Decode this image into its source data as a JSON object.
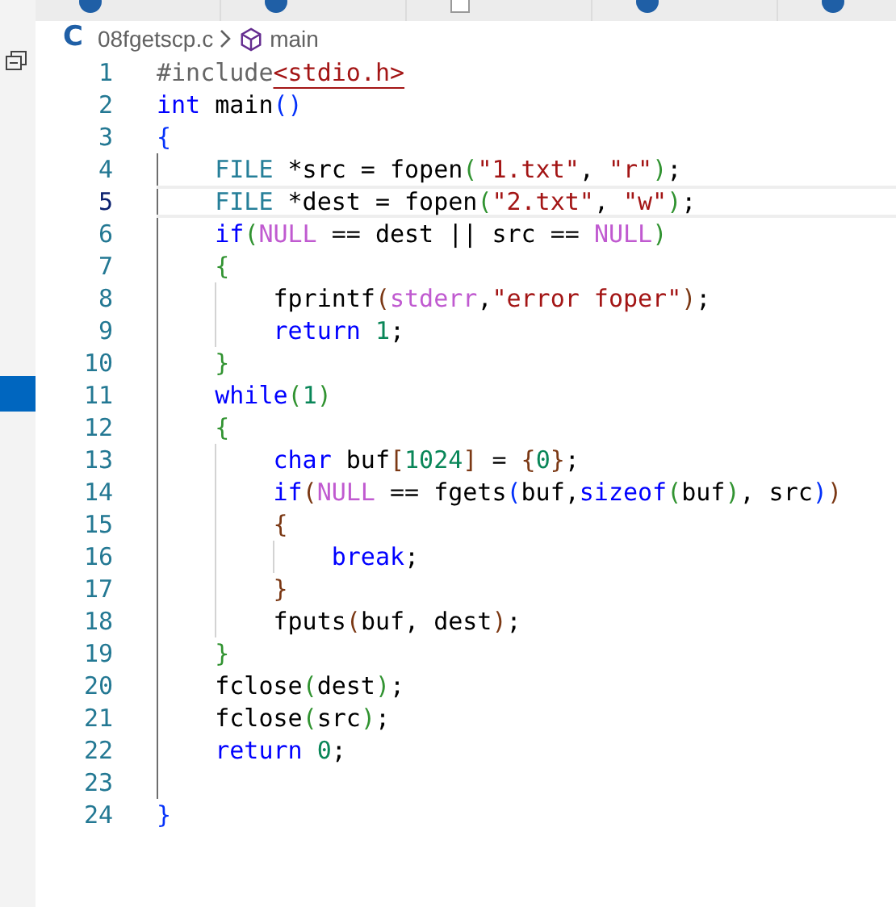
{
  "tabs": [
    {
      "kind": "c",
      "selected": false
    },
    {
      "kind": "c",
      "selected": false
    },
    {
      "kind": "text",
      "selected": false
    },
    {
      "kind": "c",
      "selected": false
    },
    {
      "kind": "c",
      "selected": false
    }
  ],
  "breadcrumb": {
    "file": "08fgetscp.c",
    "file_icon": "C",
    "symbol": "main"
  },
  "lines": [
    {
      "number": "1",
      "current": false,
      "tokens": [
        {
          "text": "#include",
          "kind": "directive"
        },
        {
          "text": "<stdio.h>",
          "kind": "include"
        }
      ]
    },
    {
      "number": "2",
      "current": false,
      "tokens": [
        {
          "text": "int",
          "kind": "keyword"
        },
        {
          "text": " main",
          "kind": "plain"
        },
        {
          "text": "()",
          "kind": "bracket1"
        }
      ]
    },
    {
      "number": "3",
      "current": false,
      "tokens": [
        {
          "text": "{",
          "kind": "bracket1"
        }
      ]
    },
    {
      "number": "4",
      "current": false,
      "tokens": [
        {
          "text": "    FILE",
          "kind": "type"
        },
        {
          "text": " *src = fopen",
          "kind": "plain"
        },
        {
          "text": "(",
          "kind": "bracket2"
        },
        {
          "text": "\"1.txt\"",
          "kind": "string"
        },
        {
          "text": ", ",
          "kind": "plain"
        },
        {
          "text": "\"r\"",
          "kind": "string"
        },
        {
          "text": ")",
          "kind": "bracket2"
        },
        {
          "text": ";",
          "kind": "plain"
        }
      ]
    },
    {
      "number": "5",
      "current": true,
      "tokens": [
        {
          "text": "    FILE",
          "kind": "type"
        },
        {
          "text": " *dest = fopen",
          "kind": "plain"
        },
        {
          "text": "(",
          "kind": "bracket2"
        },
        {
          "text": "\"2.txt\"",
          "kind": "string"
        },
        {
          "text": ", ",
          "kind": "plain"
        },
        {
          "text": "\"w\"",
          "kind": "string"
        },
        {
          "text": ")",
          "kind": "bracket2"
        },
        {
          "text": ";",
          "kind": "plain"
        }
      ]
    },
    {
      "number": "6",
      "current": false,
      "tokens": [
        {
          "text": "    if",
          "kind": "keyword"
        },
        {
          "text": "(",
          "kind": "bracket2"
        },
        {
          "text": "NULL",
          "kind": "macro"
        },
        {
          "text": " == dest || src == ",
          "kind": "plain"
        },
        {
          "text": "NULL",
          "kind": "macro"
        },
        {
          "text": ")",
          "kind": "bracket2"
        }
      ]
    },
    {
      "number": "7",
      "current": false,
      "tokens": [
        {
          "text": "    {",
          "kind": "bracket2"
        }
      ]
    },
    {
      "number": "8",
      "current": false,
      "tokens": [
        {
          "text": "        fprintf",
          "kind": "plain"
        },
        {
          "text": "(",
          "kind": "bracket3"
        },
        {
          "text": "stderr",
          "kind": "macro"
        },
        {
          "text": ",",
          "kind": "plain"
        },
        {
          "text": "\"error foper\"",
          "kind": "string"
        },
        {
          "text": ")",
          "kind": "bracket3"
        },
        {
          "text": ";",
          "kind": "plain"
        }
      ]
    },
    {
      "number": "9",
      "current": false,
      "tokens": [
        {
          "text": "        return",
          "kind": "keyword"
        },
        {
          "text": " 1",
          "kind": "number"
        },
        {
          "text": ";",
          "kind": "plain"
        }
      ]
    },
    {
      "number": "10",
      "current": false,
      "tokens": [
        {
          "text": "    }",
          "kind": "bracket2"
        }
      ]
    },
    {
      "number": "11",
      "current": false,
      "tokens": [
        {
          "text": "    while",
          "kind": "keyword"
        },
        {
          "text": "(",
          "kind": "bracket2"
        },
        {
          "text": "1",
          "kind": "number"
        },
        {
          "text": ")",
          "kind": "bracket2"
        }
      ]
    },
    {
      "number": "12",
      "current": false,
      "tokens": [
        {
          "text": "    {",
          "kind": "bracket2"
        }
      ]
    },
    {
      "number": "13",
      "current": false,
      "tokens": [
        {
          "text": "        char",
          "kind": "keyword"
        },
        {
          "text": " buf",
          "kind": "plain"
        },
        {
          "text": "[",
          "kind": "bracket3"
        },
        {
          "text": "1024",
          "kind": "number"
        },
        {
          "text": "]",
          "kind": "bracket3"
        },
        {
          "text": " = ",
          "kind": "plain"
        },
        {
          "text": "{",
          "kind": "bracket3"
        },
        {
          "text": "0",
          "kind": "number"
        },
        {
          "text": "}",
          "kind": "bracket3"
        },
        {
          "text": ";",
          "kind": "plain"
        }
      ]
    },
    {
      "number": "14",
      "current": false,
      "tokens": [
        {
          "text": "        if",
          "kind": "keyword"
        },
        {
          "text": "(",
          "kind": "bracket3"
        },
        {
          "text": "NULL",
          "kind": "macro"
        },
        {
          "text": " == fgets",
          "kind": "plain"
        },
        {
          "text": "(",
          "kind": "bracket1"
        },
        {
          "text": "buf,",
          "kind": "plain"
        },
        {
          "text": "sizeof",
          "kind": "keyword"
        },
        {
          "text": "(",
          "kind": "bracket2"
        },
        {
          "text": "buf",
          "kind": "plain"
        },
        {
          "text": ")",
          "kind": "bracket2"
        },
        {
          "text": ", src",
          "kind": "plain"
        },
        {
          "text": ")",
          "kind": "bracket1"
        },
        {
          "text": ")",
          "kind": "bracket3"
        }
      ]
    },
    {
      "number": "15",
      "current": false,
      "tokens": [
        {
          "text": "        {",
          "kind": "bracket3"
        }
      ]
    },
    {
      "number": "16",
      "current": false,
      "tokens": [
        {
          "text": "            break",
          "kind": "keyword"
        },
        {
          "text": ";",
          "kind": "plain"
        }
      ]
    },
    {
      "number": "17",
      "current": false,
      "tokens": [
        {
          "text": "        }",
          "kind": "bracket3"
        }
      ]
    },
    {
      "number": "18",
      "current": false,
      "tokens": [
        {
          "text": "        fputs",
          "kind": "plain"
        },
        {
          "text": "(",
          "kind": "bracket3"
        },
        {
          "text": "buf, dest",
          "kind": "plain"
        },
        {
          "text": ")",
          "kind": "bracket3"
        },
        {
          "text": ";",
          "kind": "plain"
        }
      ]
    },
    {
      "number": "19",
      "current": false,
      "tokens": [
        {
          "text": "    }",
          "kind": "bracket2"
        }
      ]
    },
    {
      "number": "20",
      "current": false,
      "tokens": [
        {
          "text": "    fclose",
          "kind": "plain"
        },
        {
          "text": "(",
          "kind": "bracket2"
        },
        {
          "text": "dest",
          "kind": "plain"
        },
        {
          "text": ")",
          "kind": "bracket2"
        },
        {
          "text": ";",
          "kind": "plain"
        }
      ]
    },
    {
      "number": "21",
      "current": false,
      "tokens": [
        {
          "text": "    fclose",
          "kind": "plain"
        },
        {
          "text": "(",
          "kind": "bracket2"
        },
        {
          "text": "src",
          "kind": "plain"
        },
        {
          "text": ")",
          "kind": "bracket2"
        },
        {
          "text": ";",
          "kind": "plain"
        }
      ]
    },
    {
      "number": "22",
      "current": false,
      "tokens": [
        {
          "text": "    return",
          "kind": "keyword"
        },
        {
          "text": " 0",
          "kind": "number"
        },
        {
          "text": ";",
          "kind": "plain"
        }
      ]
    },
    {
      "number": "23",
      "current": false
    },
    {
      "number": "24",
      "current": false,
      "tokens": [
        {
          "text": "}",
          "kind": "bracket1"
        }
      ]
    }
  ]
}
